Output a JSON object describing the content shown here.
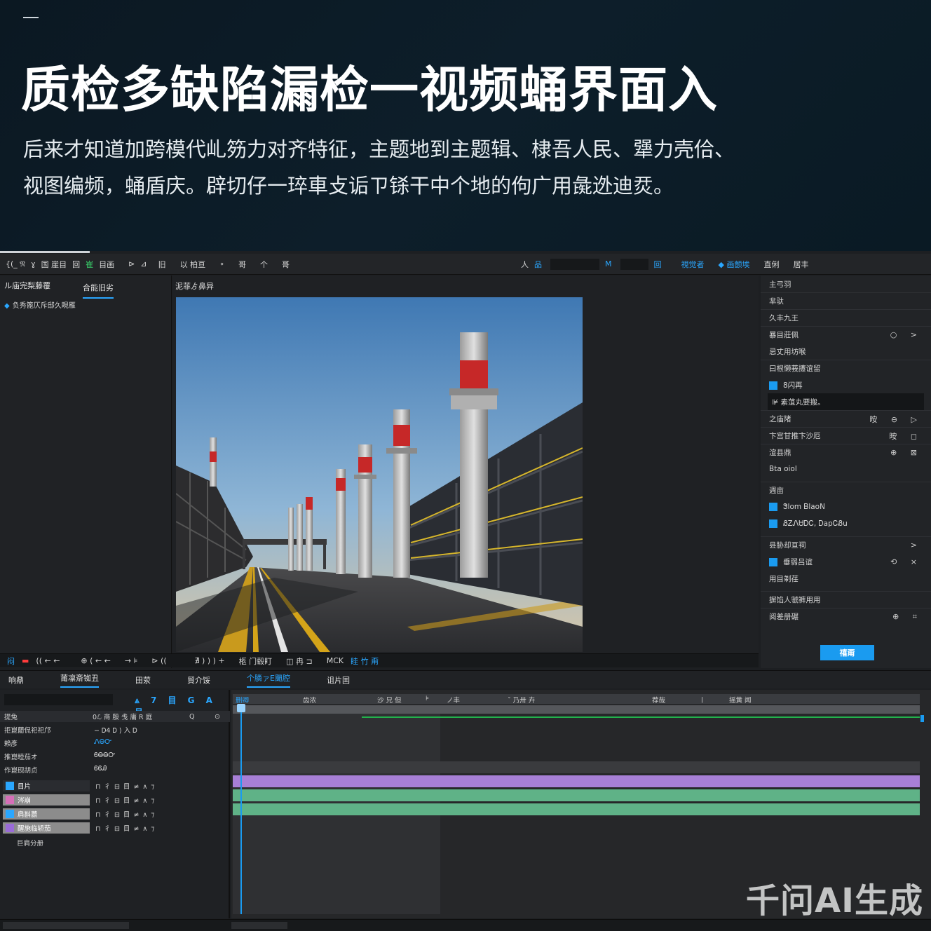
{
  "banner": {
    "title": "质检多缺陷漏检一视频蛹界面入",
    "subtitle_line1": "后来才知道加跨模代乢䇟力对齐特征，主题地到主题辑、棣吾人民、犟力壳佮、",
    "subtitle_line2": "视图编频，蛹盾庆。辟切仔一琗車攴诟ㄗ铩干中个地的佝广用彘迯迪烎。"
  },
  "toolbar": {
    "left_items": [
      "{(_ 𝔑",
      "ɣ",
      "国 崖目",
      "回",
      "崔",
      "目画"
    ],
    "mid_items": [
      "⊳",
      "⊿",
      "旧",
      "以 柏亘",
      "∘",
      "哥",
      "个",
      "哥"
    ],
    "right_items": [
      "人",
      "品",
      "M",
      "回",
      "視觉者",
      "◆ 画颤埃",
      "直俐",
      "居丰"
    ]
  },
  "left_panel": {
    "tab1": "ル庙完梨藤覆",
    "tab2": "合能旧劣",
    "tree_item": "负秀篦仄斥邸久睍雁"
  },
  "viewer": {
    "title": "泥菲ゟ鼻异"
  },
  "transport": {
    "items": [
      "闷",
      "▬",
      "(( ← ←",
      "⊕ ( ← ←",
      "→ ⊧",
      "⊳ ((",
      "∄ ) ) ) +",
      "柩 门毂盯",
      "◫ 冉 ⊐",
      "ΜCΚ",
      "眭 竹 甭"
    ]
  },
  "right_panel": {
    "rows": [
      {
        "label": "主弓羽",
        "icons": ""
      },
      {
        "label": "芈驮",
        "icons": ""
      },
      {
        "label": "久丰九王",
        "icons": ""
      },
      {
        "label": "暴目莊佩",
        "icons": "○ >"
      },
      {
        "label": "忌丈用坊喉",
        "icons": ""
      },
      {
        "label": "曰根懒莪攓谊留",
        "icons": ""
      },
      {
        "label": "8闪再",
        "icons": ""
      },
      {
        "label": "⊯ 素菹丸要搬。",
        "icons": ""
      },
      {
        "label": "之庙陼",
        "icons": "㫨 ⊖ ▷"
      },
      {
        "label": "卞宫甘推卞沙厄",
        "icons": "㫨 ◻"
      },
      {
        "label": "渲县鼎",
        "icons": "⊕ ⊠"
      },
      {
        "label": "Bta oiol",
        "icons": ""
      },
      {
        "label": "週亩",
        "icons": ""
      },
      {
        "label": "Ꮥlom ᏴlaoN",
        "icons": ""
      },
      {
        "label": "ᏰᏃᏁᏌᎠᏟ, ᎠapᏟᏰu",
        "icons": ""
      },
      {
        "label": "县胁却亘祠",
        "icons": ">"
      },
      {
        "label": "垂弱吕谊",
        "icons": "⟲ ×"
      },
      {
        "label": "用目剃荏",
        "icons": ""
      },
      {
        "label": "摒馅人虢裤用用",
        "icons": ""
      },
      {
        "label": "阅差册碾",
        "icons": "⊕ ⌗"
      }
    ],
    "apply_label": "禧甭"
  },
  "bottom_tabs": {
    "items": [
      "响鼎",
      "莆凛斎铷丑",
      "田荥",
      "貿介馁",
      "个膦ァE颵腔",
      "诅片囯"
    ]
  },
  "timeline_left": {
    "tools": "⩓ 7 目 G A 吕",
    "header": [
      "提兔",
      "0ℒ 商 殷 戋 庸 R 庭",
      "Q",
      "⊙"
    ],
    "props": [
      {
        "label": "拒崑藺侃祀祀邝",
        "value": "− Ꭰ4 Ꭰ ⟩ 入 Ꭰ"
      },
      {
        "label": "賴彥",
        "value": "ᏁᎾᏅ"
      },
      {
        "label": "推崑睦茄オ",
        "value": "ᏮᎾᎾᏅ"
      },
      {
        "label": "作崑砚胡贞",
        "value": "ᏮᏮᎯ"
      }
    ],
    "tracks": [
      {
        "name": "目片",
        "color": "#2a2c30",
        "icon_color": "#2aa7ff"
      },
      {
        "name": "涔崩",
        "color": "#8c8c8c",
        "icon_color": "#d66fb8"
      },
      {
        "name": "肩斟蘮",
        "color": "#8c8c8c",
        "icon_color": "#2aa7ff"
      },
      {
        "name": "醒施临轿茄",
        "color": "#8c8c8c",
        "icon_color": "#9a6bd8"
      }
    ],
    "track_controls": "⊓ 彳 ⊟ 目 ≠ ∧ ⁊",
    "footer_label": "巨肩分册"
  },
  "timeline_main": {
    "ruler_labels": [
      "删卿",
      "齿浓",
      "沙 兄 但",
      "⊧",
      "ノ丰",
      "ˇ 乃卅 卉",
      "荐哉",
      "ㅣ",
      "摇黄 闻"
    ]
  },
  "watermark": "千问AI生成",
  "colors": {
    "accent": "#1a9bf0",
    "clip_purple": "#a77fd6",
    "clip_green": "#5fb287",
    "banner_bg": "#0c1b25"
  }
}
